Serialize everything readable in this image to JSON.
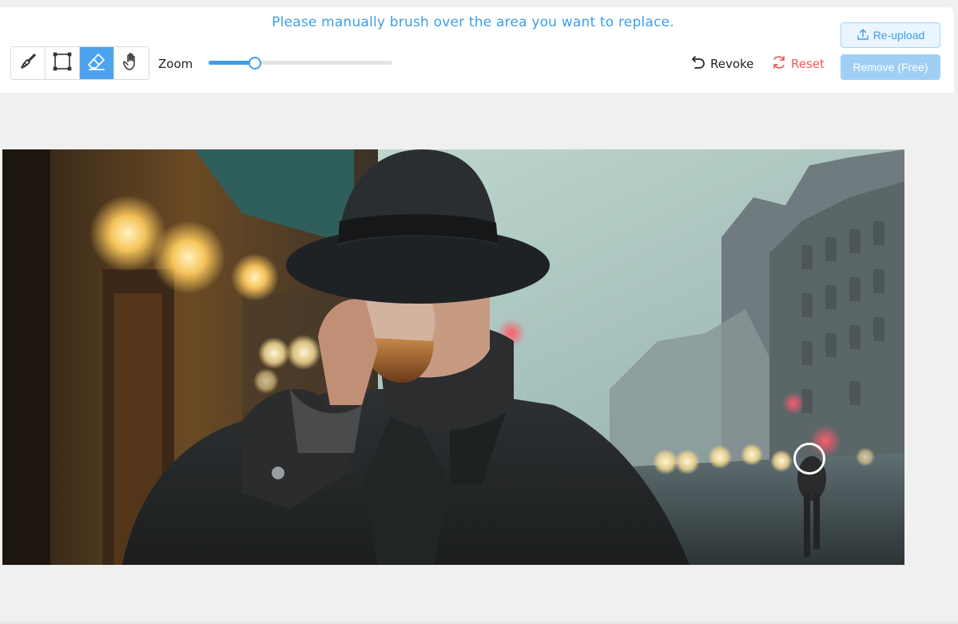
{
  "instruction": "Please manually brush over the area you want to replace.",
  "tools": [
    {
      "name": "brush",
      "icon": "brush-icon",
      "active": false
    },
    {
      "name": "rectangle",
      "icon": "rectangle-select-icon",
      "active": false
    },
    {
      "name": "eraser",
      "icon": "eraser-icon",
      "active": true
    },
    {
      "name": "hand",
      "icon": "hand-pan-icon",
      "active": false
    }
  ],
  "zoom": {
    "label": "Zoom",
    "value_fraction": 0.25
  },
  "actions": {
    "revoke_label": "Revoke",
    "reset_label": "Reset",
    "reupload_label": "Re-upload",
    "remove_label": "Remove (Free)"
  },
  "colors": {
    "accent": "#3d9de8",
    "reset": "#f05a5a",
    "remove_disabled": "#a0cff6",
    "active_tool": "#4da3ee"
  },
  "image": {
    "subject": "man in dark fedora and coat drinking from a glass on a city street"
  }
}
